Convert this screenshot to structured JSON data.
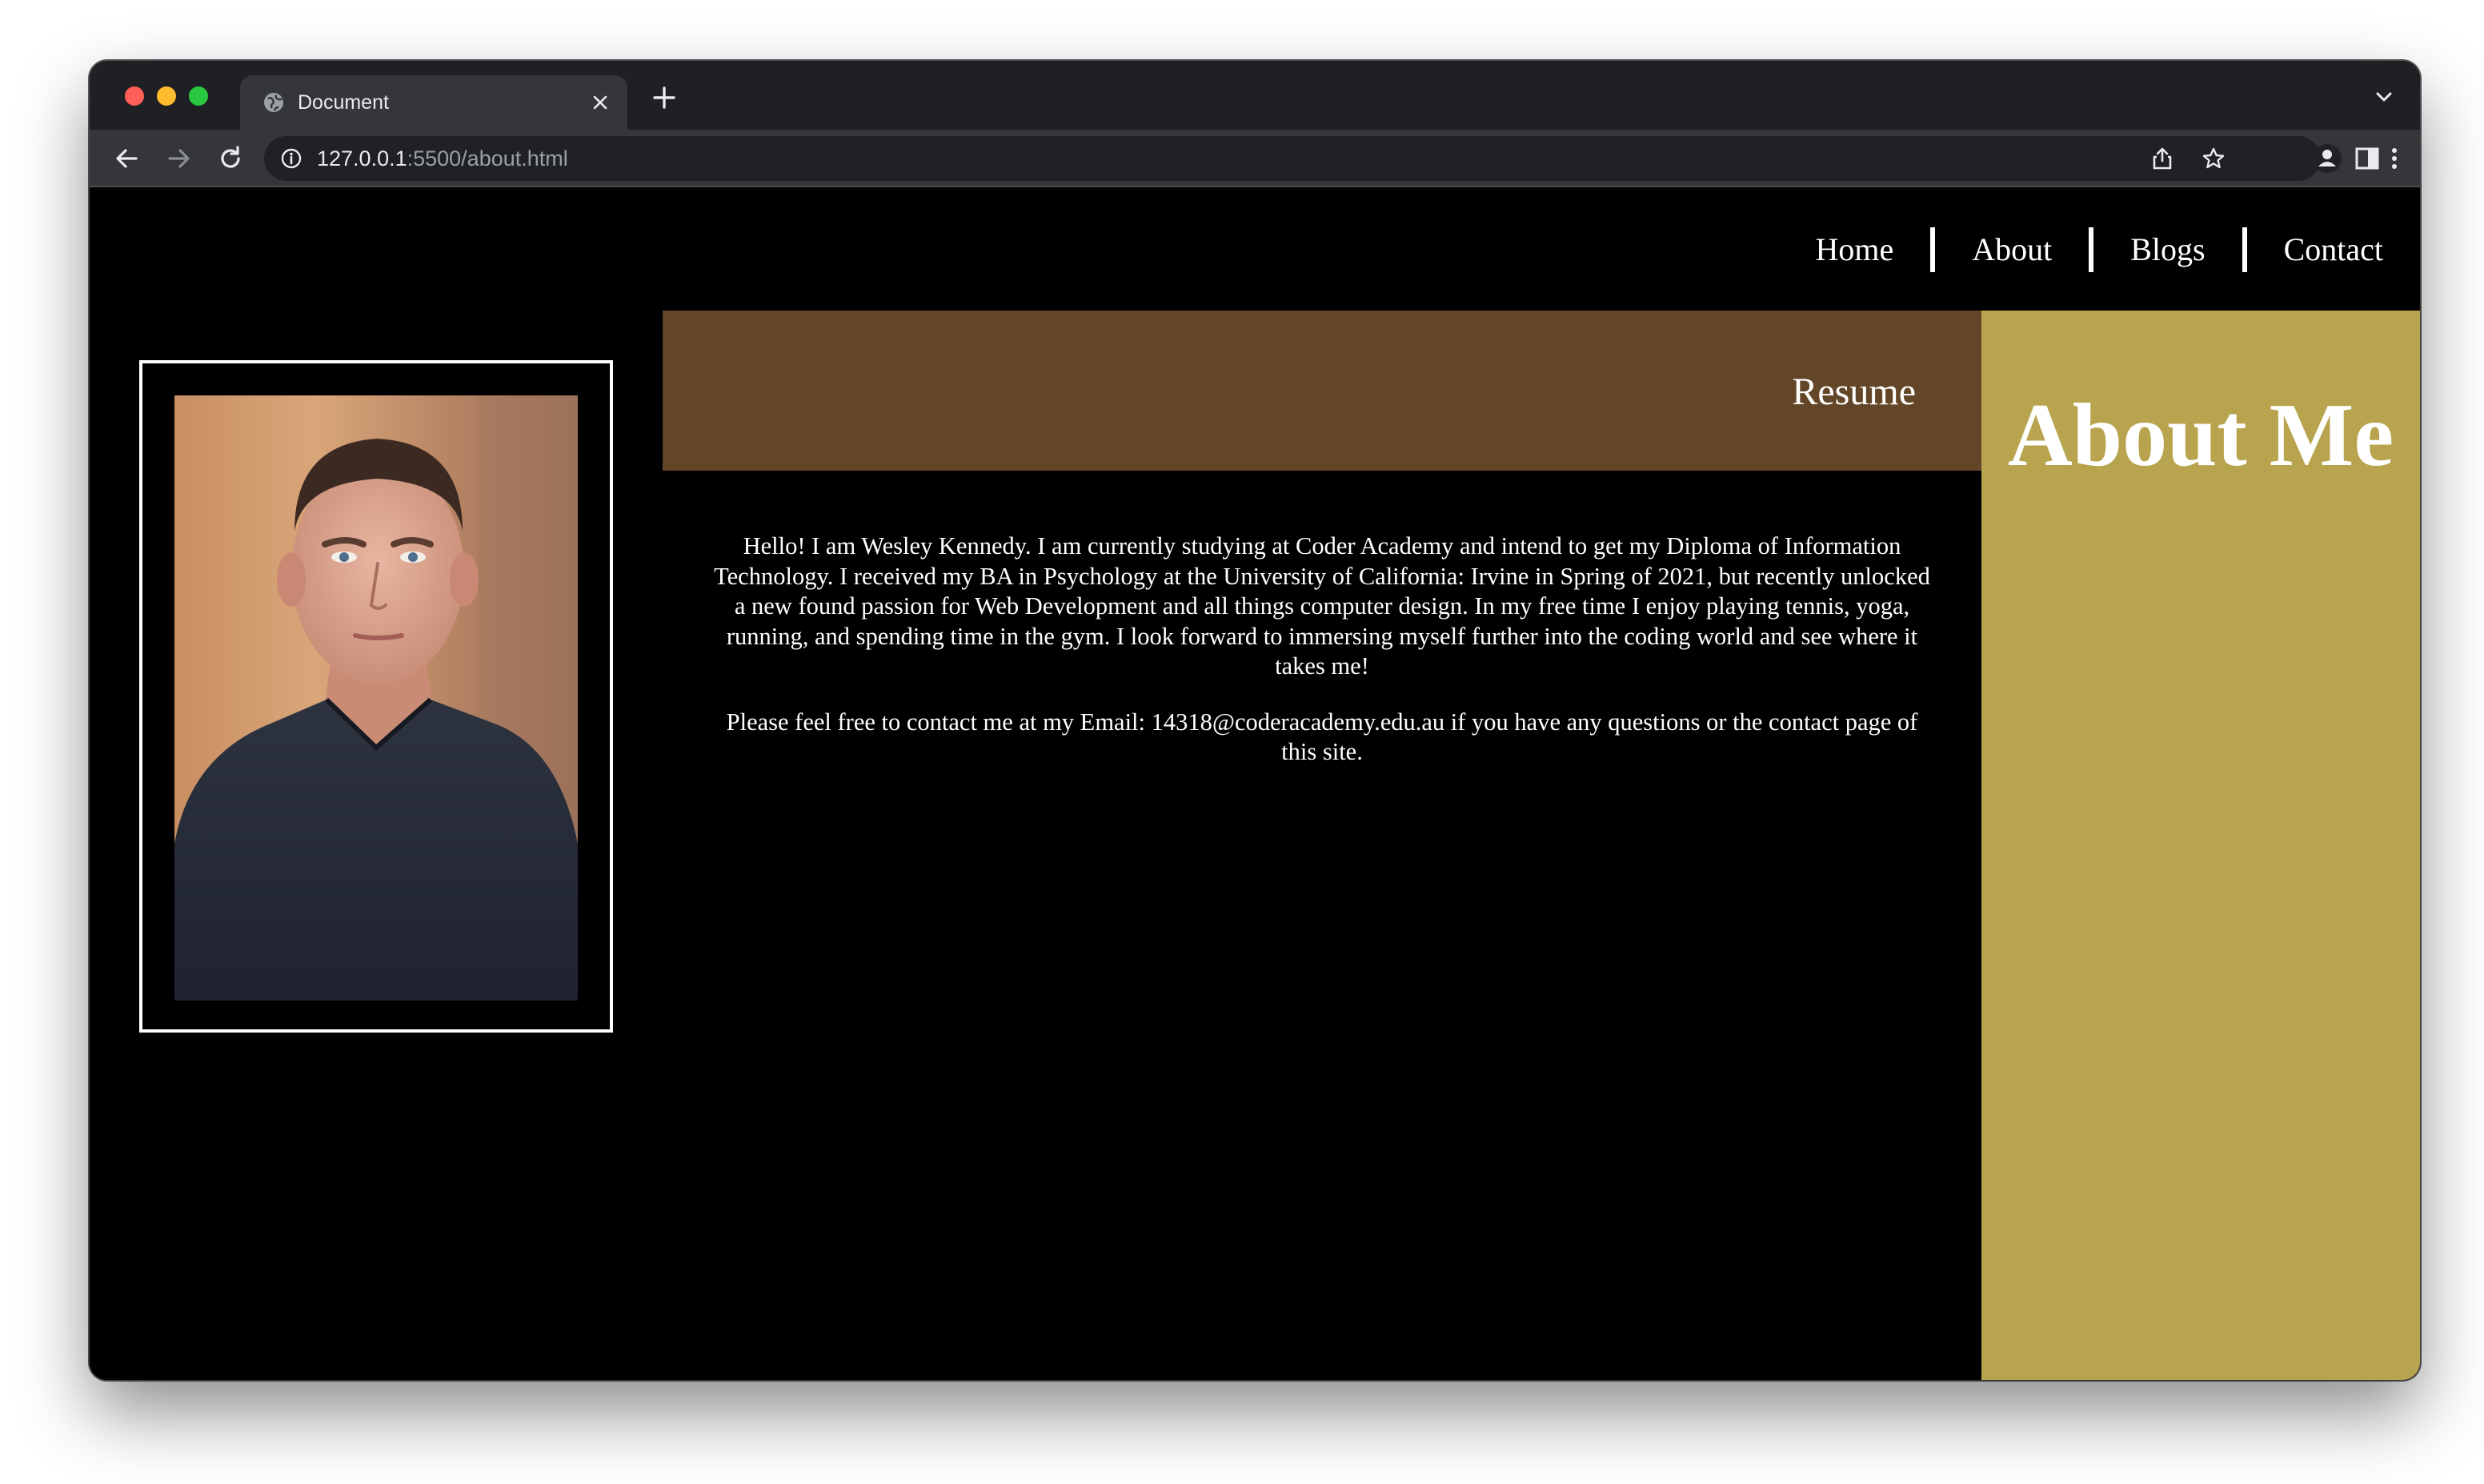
{
  "browser": {
    "tab_title": "Document",
    "url_host": "127.0.0.1",
    "url_path": ":5500/about.html",
    "icons": [
      "globe-icon",
      "close-icon",
      "plus-icon",
      "chevron-down-icon",
      "back-arrow-icon",
      "forward-arrow-icon",
      "reload-icon",
      "info-icon",
      "share-icon",
      "star-icon",
      "side-panel-icon",
      "profile-icon",
      "kebab-menu-icon"
    ]
  },
  "nav": {
    "items": [
      {
        "label": "Home"
      },
      {
        "label": "About"
      },
      {
        "label": "Blogs"
      },
      {
        "label": "Contact"
      }
    ]
  },
  "resume": {
    "title": "Resume"
  },
  "bio": {
    "paragraph1": "Hello! I am Wesley Kennedy. I am currently studying at Coder Academy and intend to get my Diploma of Information Technology. I received my BA in Psychology at the University of California: Irvine in Spring of 2021, but recently unlocked a new found passion for Web Development and all things computer design. In my free time I enjoy playing tennis, yoga, running, and spending time in the gym. I look forward to immersing myself further into the coding world and see where it takes me!",
    "paragraph2": "Please feel free to contact me at my Email: 14318@coderacademy.edu.au if you have any questions or the contact page of this site."
  },
  "aside": {
    "title": "About Me"
  },
  "colors": {
    "page_bg": "#000000",
    "resume_banner": "#634627",
    "aside_bg": "#b8a44e",
    "text": "#ffffff"
  }
}
